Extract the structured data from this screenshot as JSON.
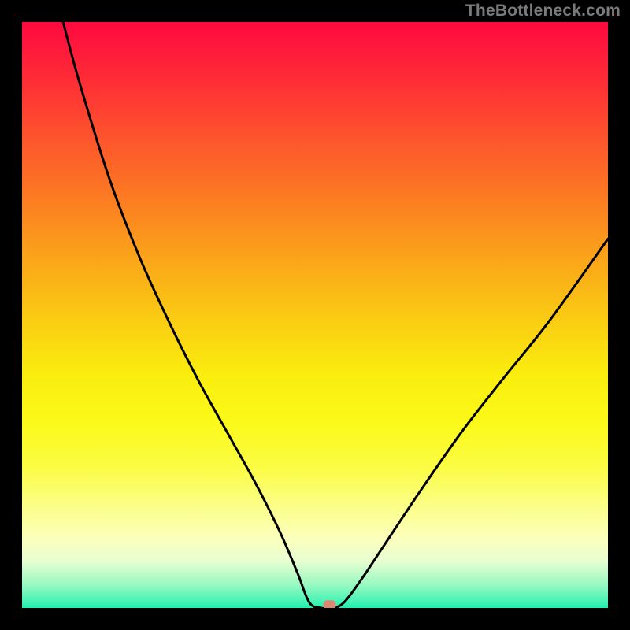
{
  "watermark": "TheBottleneck.com",
  "chart_data": {
    "type": "line",
    "title": "",
    "xlabel": "",
    "ylabel": "",
    "xlim": [
      0,
      100
    ],
    "ylim": [
      0,
      100
    ],
    "grid": false,
    "legend": false,
    "background": "rainbow-gradient-vertical",
    "curve_description": "V-shaped curve starting at top-left (≈x=7, y=100), descending steeply with rightward curvature to a flat minimum at y≈0 around x≈49-55, then rising with decreasing slope to upper-right (x=100, y≈63)",
    "series": [
      {
        "name": "bottleneck-curve",
        "x": [
          7,
          10,
          15,
          20,
          25,
          30,
          35,
          40,
          44,
          47,
          49,
          51,
          53,
          55,
          58,
          62,
          68,
          75,
          82,
          90,
          100
        ],
        "values": [
          100,
          89,
          73,
          60,
          49,
          39,
          30,
          21,
          13,
          6,
          1,
          0,
          0,
          1,
          5,
          11,
          20,
          30,
          39,
          49,
          63
        ]
      }
    ],
    "marker": {
      "name": "optimal-point",
      "x": 52.5,
      "y": 0.5,
      "color": "#d88971",
      "shape": "rounded-rect"
    }
  }
}
